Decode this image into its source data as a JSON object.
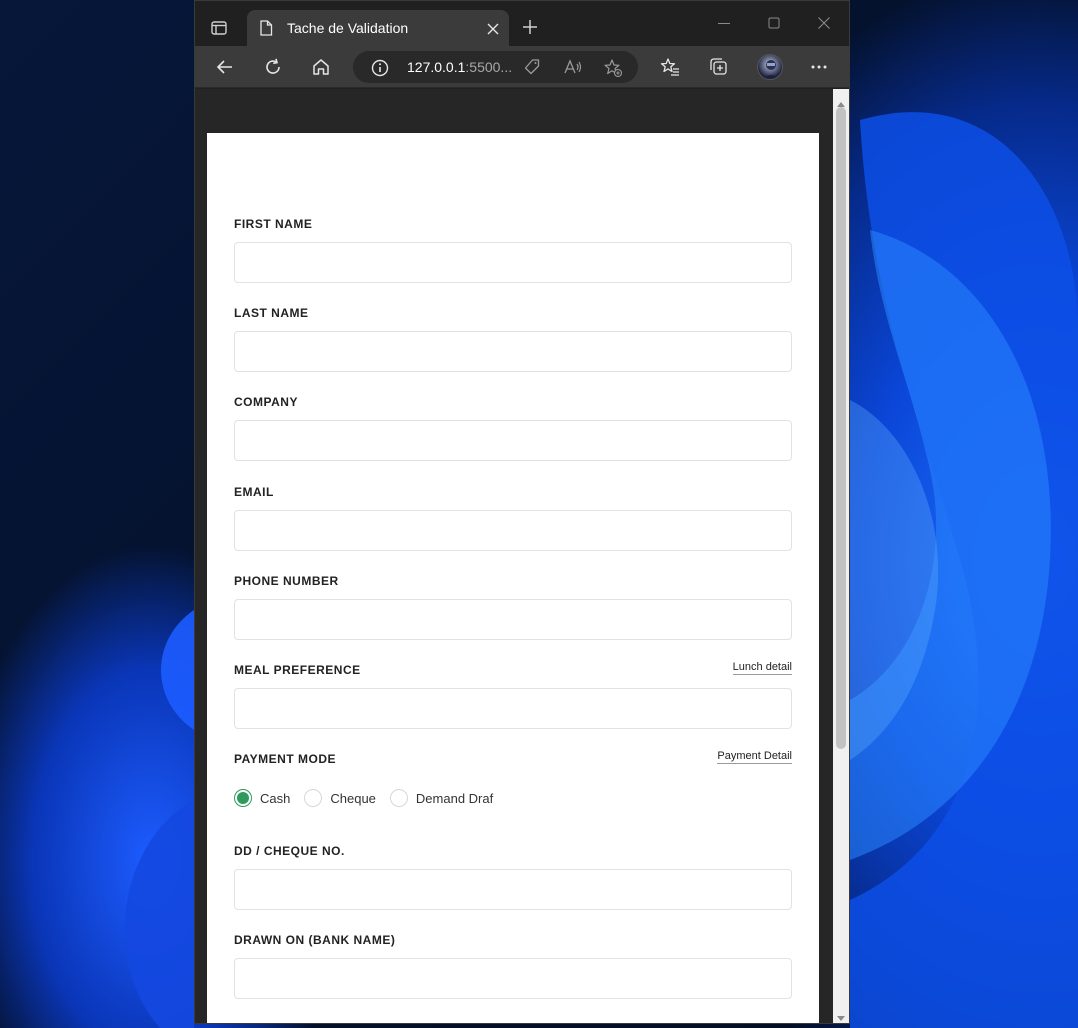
{
  "browser": {
    "tab_title": "Tache de Validation",
    "url_host": "127.0.0.1",
    "url_rest": ":5500...",
    "icons": [
      "tab-actions-icon",
      "page-icon",
      "close-icon",
      "new-tab-icon",
      "minimize-icon",
      "maximize-icon",
      "window-close-icon",
      "back-icon",
      "refresh-icon",
      "home-icon",
      "info-icon",
      "tag-icon",
      "read-aloud-icon",
      "add-favorite-icon",
      "favorites-icon",
      "collections-icon",
      "profile-avatar",
      "more-icon"
    ]
  },
  "form": {
    "first_name_label": "FIRST NAME",
    "last_name_label": "LAST NAME",
    "company_label": "COMPANY",
    "email_label": "EMAIL",
    "phone_label": "PHONE NUMBER",
    "meal_label": "MEAL PREFERENCE",
    "meal_link": "Lunch detail",
    "payment_label": "PAYMENT MODE",
    "payment_link": "Payment Detail",
    "payment_options": [
      "Cash",
      "Cheque",
      "Demand Draf"
    ],
    "payment_selected": "Cash",
    "dd_label": "DD / CHEQUE NO.",
    "bank_label": "DRAWN ON (BANK NAME)"
  },
  "colors": {
    "accent_radio": "#2e9a5b",
    "browser_chrome": "#202020",
    "toolbar": "#3b3b3b",
    "page_background": "#262626",
    "card": "#ffffff"
  }
}
